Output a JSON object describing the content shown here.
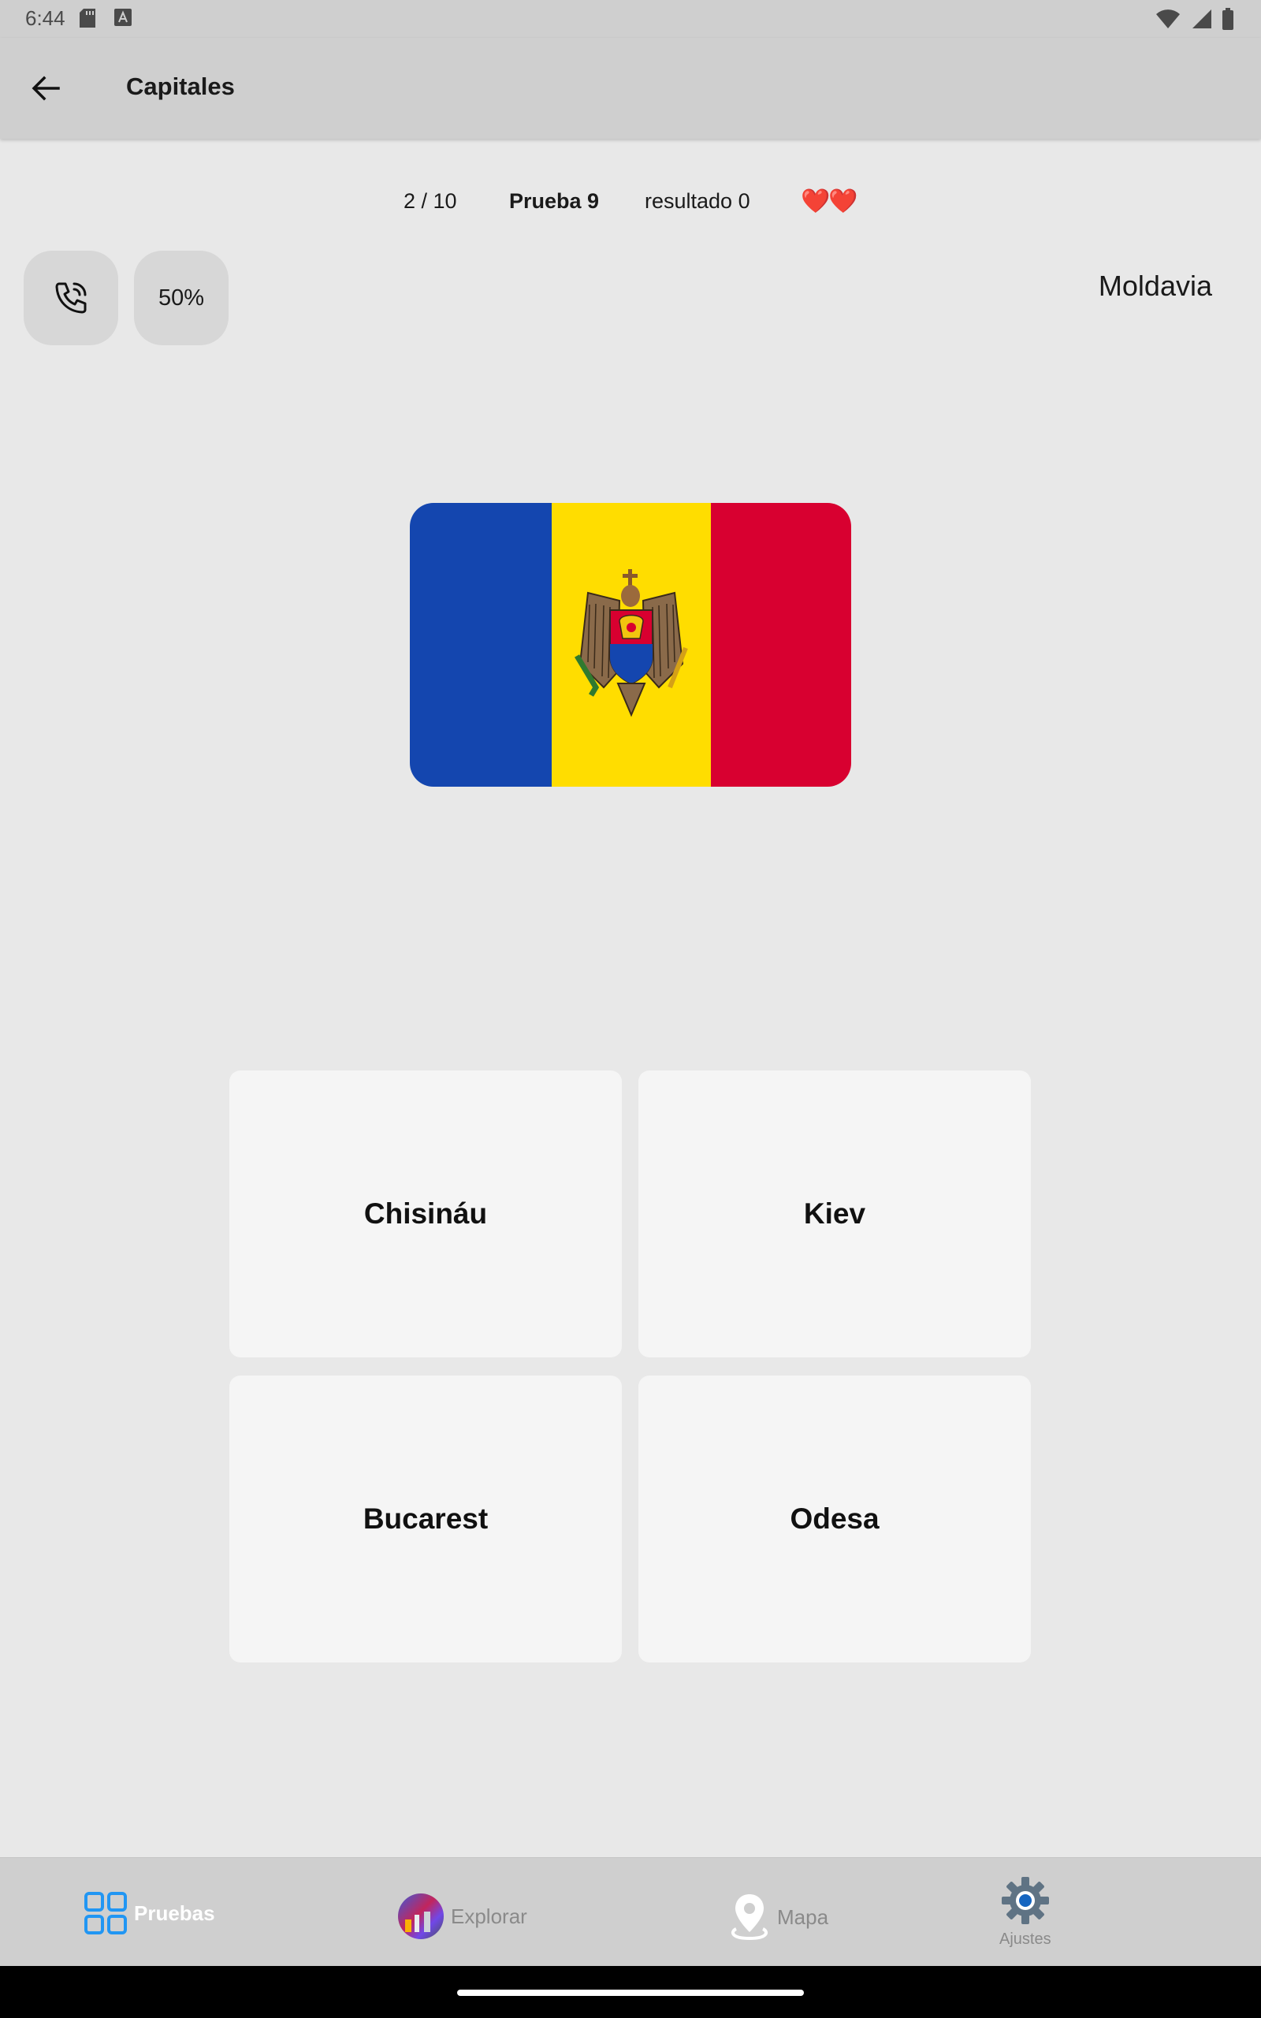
{
  "status_bar": {
    "time": "6:44",
    "icons": [
      "sd-card-icon",
      "keyboard-icon",
      "wifi-icon",
      "signal-icon",
      "battery-icon"
    ]
  },
  "app_bar": {
    "title": "Capitales",
    "back_icon": "arrow-left-icon"
  },
  "quiz": {
    "progress": "2 / 10",
    "test_label": "Prueba 9",
    "score_label": "resultado 0",
    "lives": "❤️❤️",
    "lives_count": 2,
    "country": "Moldavia"
  },
  "hints": {
    "call_icon": "phone-call-icon",
    "half_label": "50%"
  },
  "flag": {
    "name": "flag-moldova",
    "colors": [
      "#1446af",
      "#ffdd00",
      "#d80030"
    ]
  },
  "answers": [
    "Chisináu",
    "Kiev",
    "Bucarest",
    "Odesa"
  ],
  "bottom_nav": {
    "active": "Pruebas",
    "accent": "#2196f3",
    "items": [
      {
        "label": "Pruebas",
        "icon": "grid-icon"
      },
      {
        "label": "Explorar",
        "icon": "globe-icon"
      },
      {
        "label": "Mapa",
        "icon": "map-pin-icon"
      },
      {
        "label": "Ajustes",
        "icon": "gear-icon"
      }
    ]
  }
}
